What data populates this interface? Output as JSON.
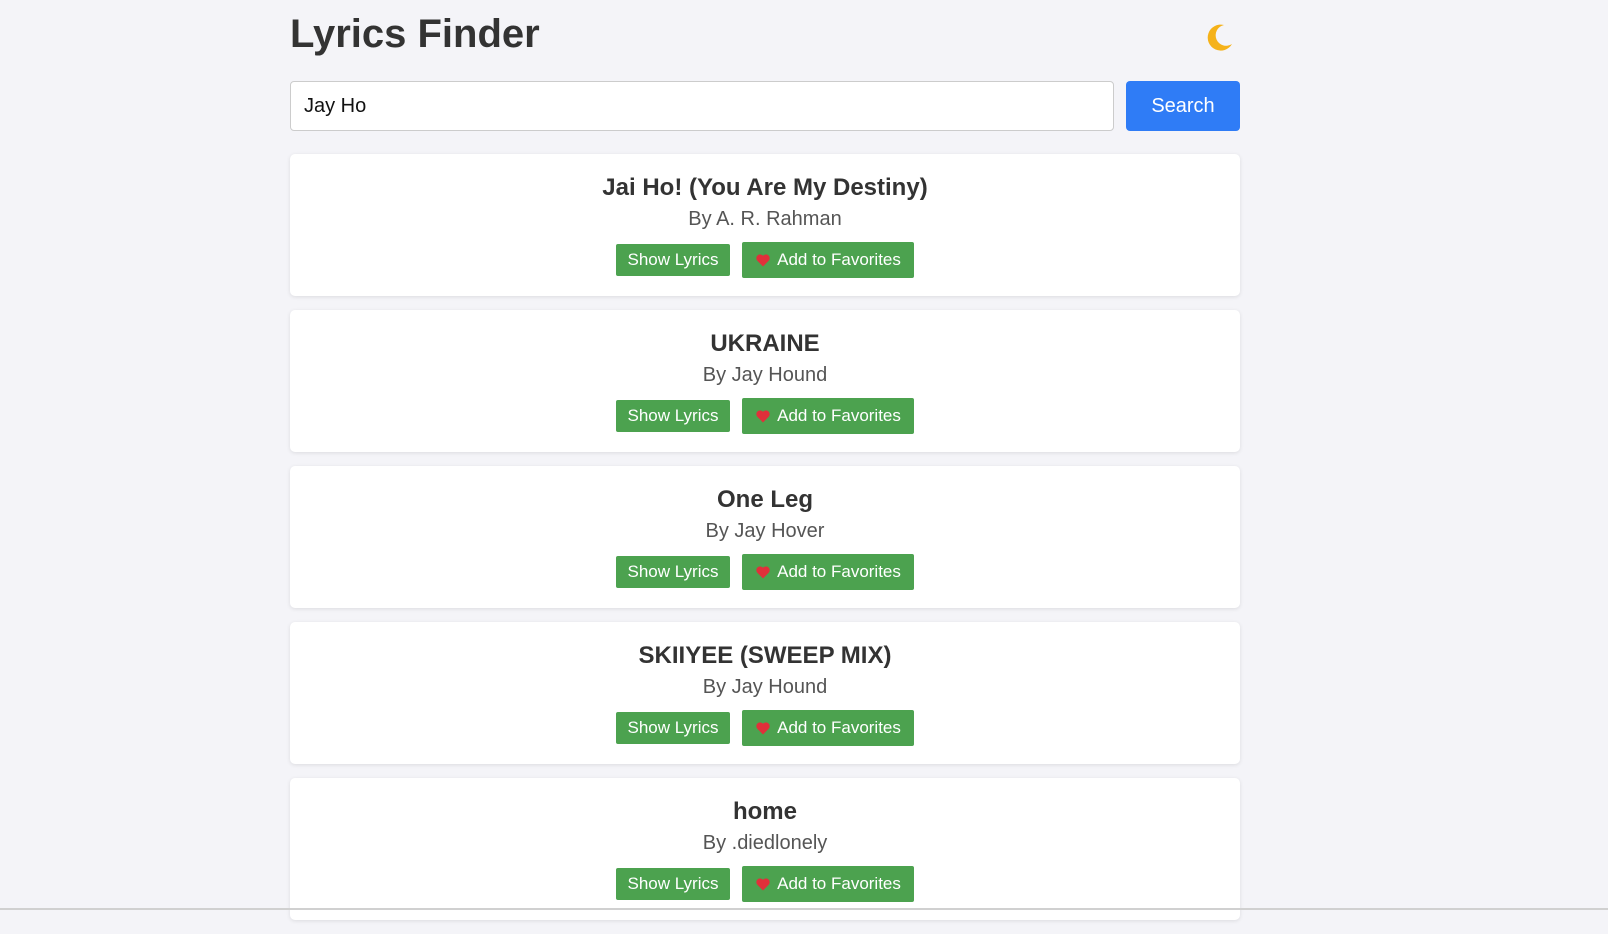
{
  "header": {
    "title": "Lyrics Finder",
    "theme_toggle_icon": "moon-icon"
  },
  "search": {
    "value": "Jay Ho",
    "button_label": "Search"
  },
  "results": [
    {
      "title": "Jai Ho! (You Are My Destiny)",
      "artist": "By A. R. Rahman",
      "show_lyrics_label": "Show Lyrics",
      "favorite_label": "Add to Favorites"
    },
    {
      "title": "UKRAINE",
      "artist": "By Jay Hound",
      "show_lyrics_label": "Show Lyrics",
      "favorite_label": "Add to Favorites"
    },
    {
      "title": "One Leg",
      "artist": "By Jay Hover",
      "show_lyrics_label": "Show Lyrics",
      "favorite_label": "Add to Favorites"
    },
    {
      "title": "SKIIYEE (SWEEP MIX)",
      "artist": "By Jay Hound",
      "show_lyrics_label": "Show Lyrics",
      "favorite_label": "Add to Favorites"
    },
    {
      "title": "home",
      "artist": "By .diedlonely",
      "show_lyrics_label": "Show Lyrics",
      "favorite_label": "Add to Favorites"
    }
  ],
  "colors": {
    "accent_blue": "#2f7cf6",
    "action_green": "#4ca24f",
    "background": "#f4f4f8",
    "heart_red": "#e0303a",
    "moon_yellow": "#f5b21a"
  }
}
